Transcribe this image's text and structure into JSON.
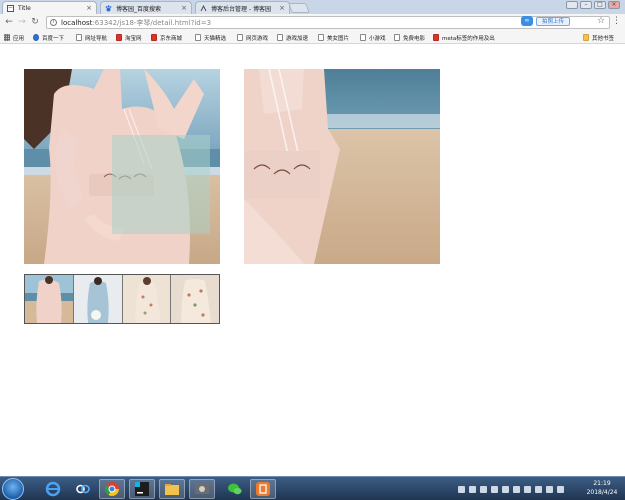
{
  "browser": {
    "tabs": [
      {
        "label": "Title",
        "icon": "page-icon",
        "active": true
      },
      {
        "label": "博客园_百度搜索",
        "icon": "baidu-paw-icon",
        "active": false
      },
      {
        "label": "博客后台管理 - 博客园",
        "icon": "cnblogs-icon",
        "active": false
      }
    ],
    "close_glyph": "×",
    "url_host": "localhost",
    "url_path": ":63342/js18-李琴/detail.html?id=3",
    "upload_label": "拍照上传",
    "bookmarks": [
      {
        "label": "应用",
        "icon": "apps-grid-icon"
      },
      {
        "label": "百度一下",
        "icon": "baidu-paw-icon"
      },
      {
        "label": "网址导航",
        "icon": "page-icon"
      },
      {
        "label": "淘宝网",
        "icon": "taobao-icon"
      },
      {
        "label": "京东商城",
        "icon": "jd-icon"
      },
      {
        "label": "天猫精选",
        "icon": "page-icon"
      },
      {
        "label": "网页游戏",
        "icon": "page-icon"
      },
      {
        "label": "游戏加速",
        "icon": "page-icon"
      },
      {
        "label": "美女图片",
        "icon": "page-icon"
      },
      {
        "label": "小游戏",
        "icon": "page-icon"
      },
      {
        "label": "免费电影",
        "icon": "page-icon"
      },
      {
        "label": "meta标签的作用及出",
        "icon": "csdn-icon"
      }
    ],
    "other_bookmarks": "其他书签"
  },
  "page": {
    "main_image": "product-photo-woman-pink-dress-beach",
    "zoom_image": "product-photo-zoomed-detail",
    "thumbnails": [
      {
        "name": "thumbnail-1",
        "theme": "pink-dress-beach"
      },
      {
        "name": "thumbnail-2",
        "theme": "blue-dress"
      },
      {
        "name": "thumbnail-3",
        "theme": "floral-dress"
      },
      {
        "name": "thumbnail-4",
        "theme": "floral-dress-indoor"
      }
    ]
  },
  "taskbar": {
    "time": "21:19",
    "date": "2018/4/24"
  },
  "colors": {
    "tabbar": "#c9d6e8",
    "taskbar": "#1f3552",
    "lens": "#aad2c8"
  }
}
